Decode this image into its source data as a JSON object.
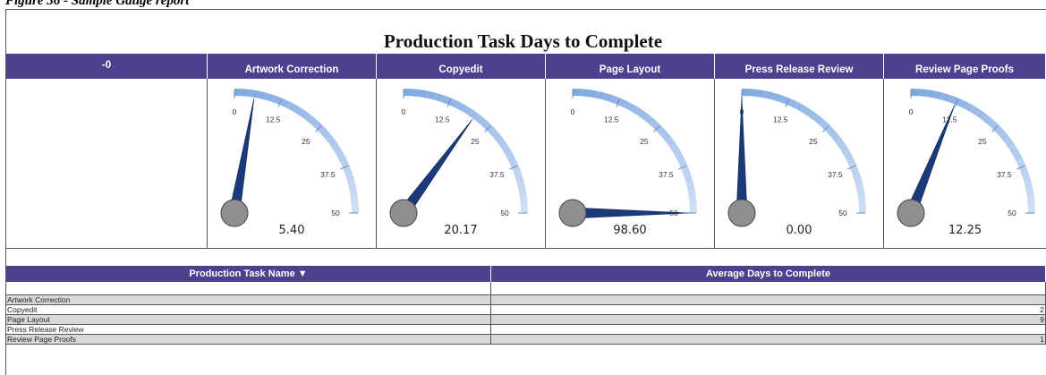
{
  "figure_caption": "Figure 36 - Sample Gauge report",
  "report": {
    "title": "Production Task Days to Complete",
    "header_first_cell": "-0"
  },
  "gauges": [
    {
      "label": "Artwork Correction",
      "value": 5.4,
      "value_text": "5.40"
    },
    {
      "label": "Copyedit",
      "value": 20.17,
      "value_text": "20.17"
    },
    {
      "label": "Page Layout",
      "value": 98.6,
      "value_text": "98.60"
    },
    {
      "label": "Press Release Review",
      "value": 0.0,
      "value_text": "0.00"
    },
    {
      "label": "Review Page Proofs",
      "value": 12.25,
      "value_text": "12.25"
    }
  ],
  "gauge_scale": {
    "min": 0,
    "max": 50,
    "ticks": [
      "0",
      "12.5",
      "25",
      "37.5",
      "50"
    ]
  },
  "colors": {
    "header_bg": "#4e3f8f",
    "needle": "#1a3a7a",
    "arc": "#7ea8e0",
    "hub": "#8f8f8f",
    "row_shade": "#d9d9d9"
  },
  "table": {
    "columns": [
      "Production Task Name ▼",
      "Average Days to Complete"
    ],
    "rows": [
      {
        "name": "Artwork Correction",
        "value": ""
      },
      {
        "name": "Copyedit",
        "value": "2"
      },
      {
        "name": "Page Layout",
        "value": "9"
      },
      {
        "name": "Press Release Review",
        "value": ""
      },
      {
        "name": "Review Page Proofs",
        "value": "1"
      }
    ]
  }
}
